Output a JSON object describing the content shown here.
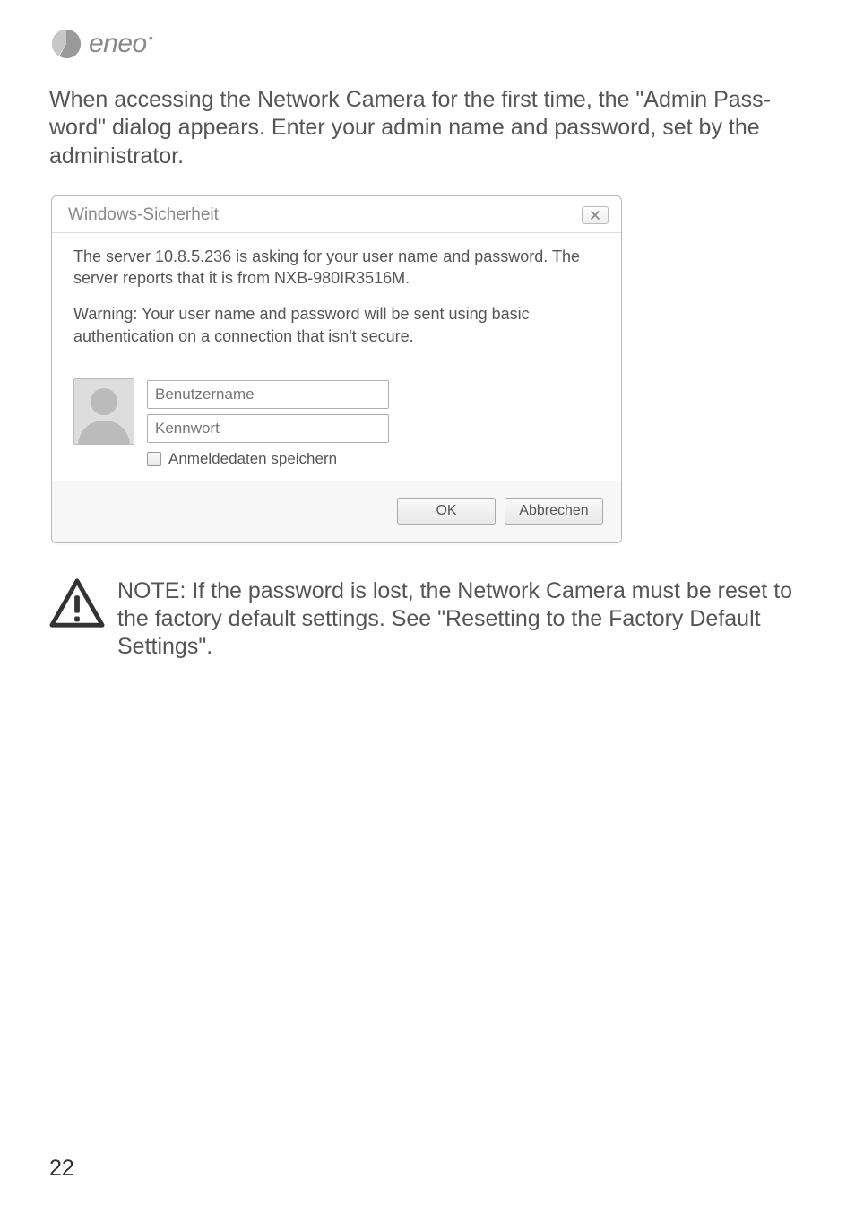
{
  "logo": {
    "text": "eneo"
  },
  "intro": "When accessing the Network Camera for the first time, the \"Admin Pass­word\" dialog appears. Enter your admin name and password, set by the administrator.",
  "dialog": {
    "title": "Windows-Sicherheit",
    "body1": "The server 10.8.5.236 is asking for your user name and password. The server reports that it is from NXB-980IR3516M.",
    "body2": "Warning: Your user name and password will be sent using basic authentication on a connection that isn't secure.",
    "username_placeholder": "Benutzername",
    "password_placeholder": "Kennwort",
    "remember_label": "Anmeldedaten speichern",
    "ok_label": "OK",
    "cancel_label": "Abbrechen"
  },
  "note": "NOTE: If the password is lost, the Network Camera must be reset to the factory default settings. See \"Resetting to the Factory Default Settings\".",
  "page_number": "22"
}
